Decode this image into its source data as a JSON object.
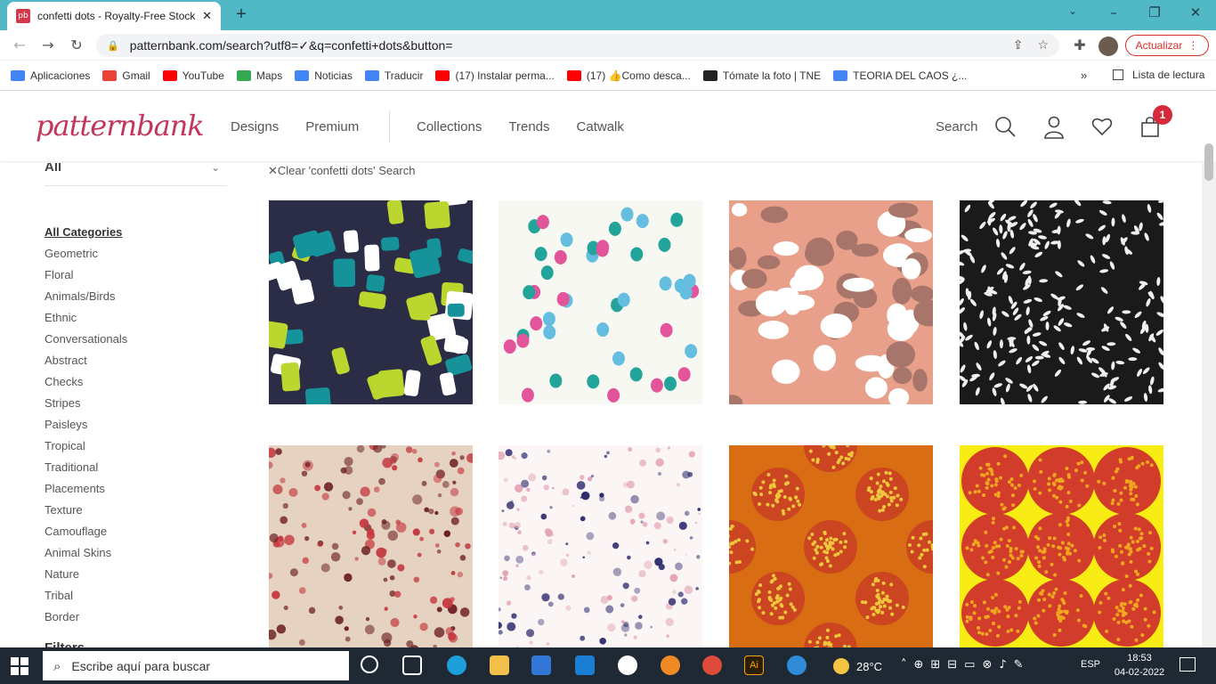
{
  "browser": {
    "tab_title": "confetti dots - Royalty-Free Stock",
    "tab_favicon_text": "pb",
    "url": "patternbank.com/search?utf8=✓&q=confetti+dots&button=",
    "update_label": "Actualizar",
    "bookmarks": [
      {
        "label": "Aplicaciones",
        "icon": "apps-grid-icon",
        "color": "#4285f4"
      },
      {
        "label": "Gmail",
        "icon": "gmail-icon",
        "color": "#ea4335"
      },
      {
        "label": "YouTube",
        "icon": "youtube-icon",
        "color": "#ff0000"
      },
      {
        "label": "Maps",
        "icon": "maps-icon",
        "color": "#34a853"
      },
      {
        "label": "Noticias",
        "icon": "news-icon",
        "color": "#4285f4"
      },
      {
        "label": "Traducir",
        "icon": "translate-icon",
        "color": "#4285f4"
      },
      {
        "label": "(17) Instalar perma...",
        "icon": "youtube-icon",
        "color": "#ff0000"
      },
      {
        "label": "(17) 👍Como desca...",
        "icon": "youtube-icon",
        "color": "#ff0000"
      },
      {
        "label": "Tómate la foto | TNE",
        "icon": "globe-icon",
        "color": "#222222"
      },
      {
        "label": "TEORIA DEL CAOS ¿...",
        "icon": "google-icon",
        "color": "#4285f4"
      }
    ],
    "bookmarks_more": "»",
    "reading_list": "Lista de lectura"
  },
  "site": {
    "logo": "patternbank",
    "nav_primary": [
      "Designs",
      "Premium"
    ],
    "nav_secondary": [
      "Collections",
      "Trends",
      "Catwalk"
    ],
    "search_label": "Search",
    "cart_count": "1"
  },
  "sidebar": {
    "select_value": "All",
    "categories": [
      "All Categories",
      "Geometric",
      "Floral",
      "Animals/Birds",
      "Ethnic",
      "Conversationals",
      "Abstract",
      "Checks",
      "Stripes",
      "Paisleys",
      "Tropical",
      "Traditional",
      "Placements",
      "Texture",
      "Camouflage",
      "Animal Skins",
      "Nature",
      "Tribal",
      "Border"
    ],
    "filters_heading": "Filters"
  },
  "results": {
    "clear_label": "Clear 'confetti dots' Search",
    "tiles": [
      {
        "name": "navy-lime-teal-brush-confetti",
        "colors": [
          "#2a2d45",
          "#bcd630",
          "#16939a",
          "#ffffff"
        ]
      },
      {
        "name": "white-multicolor-dots",
        "colors": [
          "#f8f8f3",
          "#e3559a",
          "#23a49a",
          "#65bde0"
        ]
      },
      {
        "name": "peach-brown-white-spots",
        "colors": [
          "#e8a08a",
          "#a7756a",
          "#ffffff"
        ]
      },
      {
        "name": "black-white-rice-confetti",
        "colors": [
          "#1a1a1a",
          "#f0f0f0"
        ]
      },
      {
        "name": "beige-red-dot-confetti",
        "colors": [
          "#e6d2c0",
          "#c4393f",
          "#6b1e22"
        ]
      },
      {
        "name": "white-pink-speckled-dots",
        "colors": [
          "#fbf5f5",
          "#e3a3b4",
          "#2d2a6c"
        ]
      },
      {
        "name": "orange-circle-confetti",
        "colors": [
          "#d86d13",
          "#ca4520",
          "#f0c63c"
        ]
      },
      {
        "name": "yellow-circle-confetti",
        "colors": [
          "#f7ed14",
          "#d13d2a",
          "#f2a51f"
        ]
      }
    ]
  },
  "taskbar": {
    "search_placeholder": "Escribe aquí para buscar",
    "temperature": "28°C",
    "language": "ESP",
    "time": "18:53",
    "date": "04-02-2022",
    "notifications": "1"
  }
}
